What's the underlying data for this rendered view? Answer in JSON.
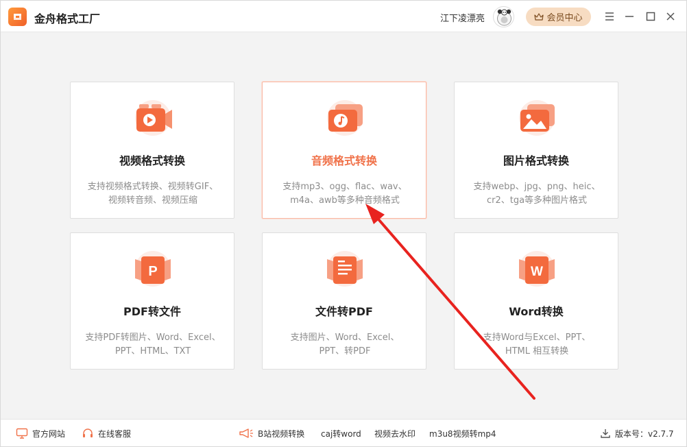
{
  "app": {
    "title": "金舟格式工厂",
    "username": "江下凌漂亮",
    "vip_label": "会员中心",
    "icons": {
      "logo": "app-logo-icon",
      "vip": "crown-icon",
      "menu": "menu-icon",
      "minimize": "minimize-icon",
      "maximize": "maximize-icon",
      "close": "close-icon"
    }
  },
  "cards": [
    {
      "title": "视频格式转换",
      "desc": "支持视频格式转换、视频转GIF、\n视频转音频、视频压缩",
      "icon": "video-convert-icon"
    },
    {
      "title": "音频格式转换",
      "desc": "支持mp3、ogg、flac、wav、\nm4a、awb等多种音频格式",
      "icon": "audio-convert-icon"
    },
    {
      "title": "图片格式转换",
      "desc": "支持webp、jpg、png、heic、\ncr2、tga等多种图片格式",
      "icon": "image-convert-icon"
    },
    {
      "title": "PDF转文件",
      "desc": "支持PDF转图片、Word、Excel、\nPPT、HTML、TXT",
      "icon": "pdf-letter-icon"
    },
    {
      "title": "文件转PDF",
      "desc": "支持图片、Word、Excel、\nPPT、转PDF",
      "icon": "document-lines-icon"
    },
    {
      "title": "Word转换",
      "desc": "支持Word与Excel、PPT、\nHTML 相互转换",
      "icon": "word-letter-icon"
    }
  ],
  "cards_icon_letters": {
    "pdf": "P",
    "word": "W"
  },
  "bottombar": {
    "website": "官方网站",
    "support": "在线客服",
    "bilibili": "B站视频转换",
    "caj": "caj转word",
    "watermark": "视频去水印",
    "m3u8": "m3u8视频转mp4",
    "version": "版本号：v2.7.7"
  },
  "colors": {
    "accent": "#f0724a",
    "annotation_arrow": "#e8231f",
    "vip_bg": "#f7dcc2"
  }
}
